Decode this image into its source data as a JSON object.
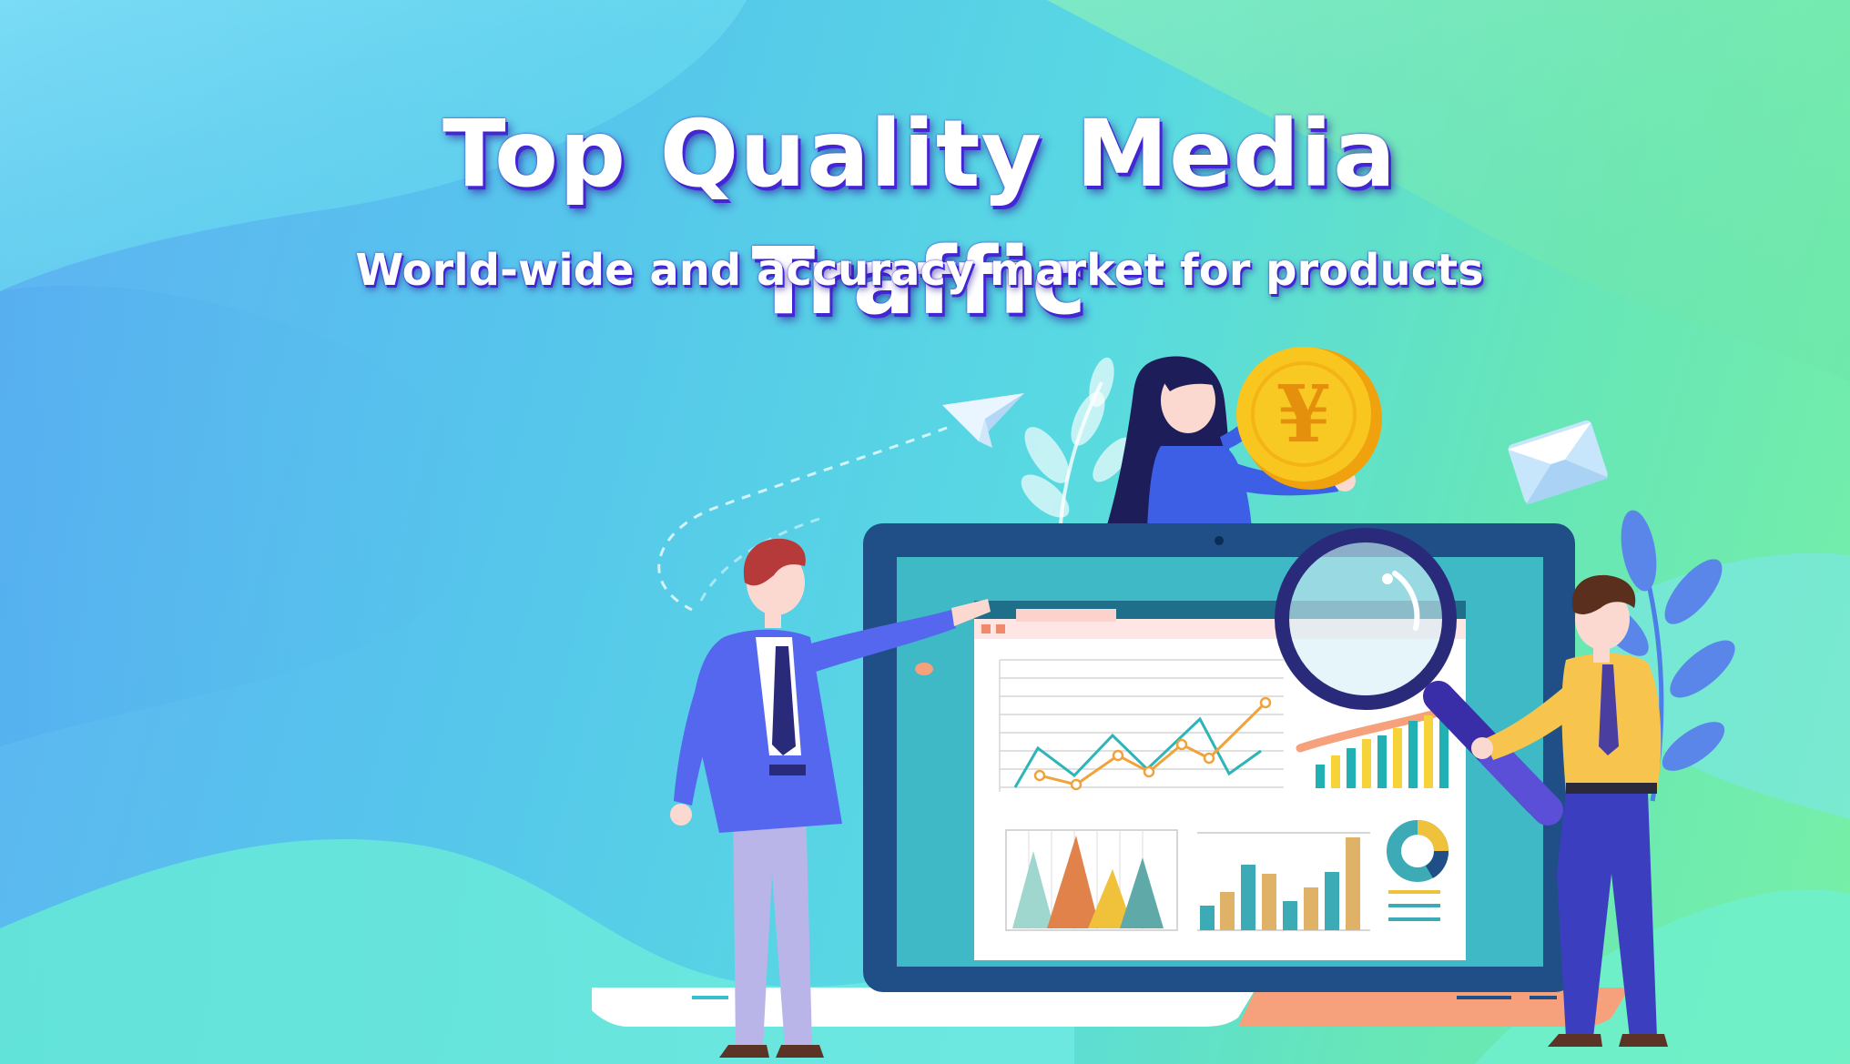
{
  "banner": {
    "headline": "Top Quality Media Traffic",
    "subheadline": "World-wide and accuracy market for products"
  },
  "coin": {
    "symbol": "¥"
  },
  "colors": {
    "headline_shadow": "#4527d6",
    "monitor_frame": "#1f4f86",
    "screen_bg": "#3fb9c6",
    "coin_gold": "#f6c21a",
    "chart_teal": "#2fb4b7",
    "chart_orange": "#f0a33a"
  },
  "icons": [
    "paper-plane-icon",
    "envelope-icon",
    "magnifying-glass-icon",
    "yen-coin-icon",
    "leaf-icon"
  ]
}
